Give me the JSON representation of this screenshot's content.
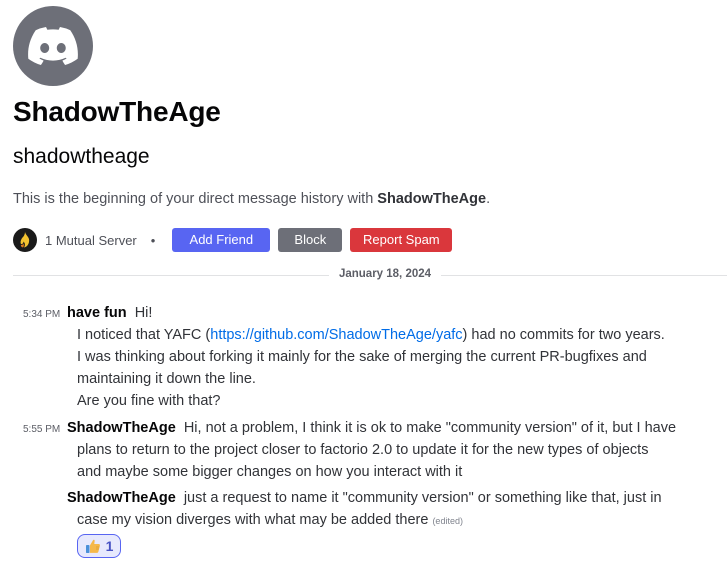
{
  "profile": {
    "display_name": "ShadowTheAge",
    "username": "shadowtheage",
    "intro_prefix": "This is the beginning of your direct message history with ",
    "intro_name": "ShadowTheAge",
    "intro_suffix": ".",
    "mutual_servers": "1 Mutual Server",
    "separator": "•"
  },
  "actions": {
    "add_friend": "Add Friend",
    "block": "Block",
    "report_spam": "Report Spam"
  },
  "divider": {
    "date": "January 18, 2024"
  },
  "messages": [
    {
      "time": "5:34 PM",
      "author": "have fun",
      "first_line": "Hi!",
      "line2_prefix": "I noticed that YAFC (",
      "line2_link": "https://github.com/ShadowTheAge/yafc",
      "line2_suffix": ") had no commits for two years.",
      "line3": "I was thinking about forking it mainly for the sake of merging the current PR-bugfixes and",
      "line4": "maintaining it down the line.",
      "line5": "Are you fine with that?"
    },
    {
      "time": "5:55 PM",
      "author": "ShadowTheAge",
      "first_line": "Hi, not a problem, I think it is ok to make \"community version\" of it, but I have",
      "line2": "plans to return to the project closer to factorio 2.0 to update it for the new types of objects",
      "line3": "and maybe some bigger changes on how you interact with it"
    },
    {
      "author": "ShadowTheAge",
      "first_line": "just a request to name it \"community version\" or something like that, just in",
      "line2": "case my vision diverges with what may be added there",
      "edited": "(edited)"
    }
  ],
  "reaction": {
    "emoji": "thumbs-up-icon",
    "count": "1"
  },
  "colors": {
    "blurple": "#5865f2",
    "block_gray": "#6d6f78",
    "danger_red": "#da373c",
    "link_blue": "#006ce7",
    "avatar_gray": "#6d6f78"
  }
}
